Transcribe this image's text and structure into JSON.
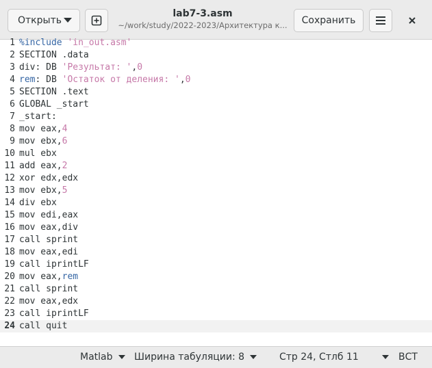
{
  "header": {
    "open_label": "Открыть",
    "save_label": "Сохранить",
    "title": "lab7-3.asm",
    "path": "~/work/study/2022-2023/Архитектура к..."
  },
  "editor": {
    "current_line": 24,
    "lines": [
      {
        "n": "1",
        "parts": [
          [
            "pp",
            "%include "
          ],
          [
            "str",
            "'in_out.asm'"
          ]
        ]
      },
      {
        "n": "2",
        "parts": [
          [
            "t",
            "SECTION .data"
          ]
        ]
      },
      {
        "n": "3",
        "parts": [
          [
            "t",
            "div: DB "
          ],
          [
            "str",
            "'Результат: '"
          ],
          [
            "t",
            ","
          ],
          [
            "num",
            "0"
          ]
        ]
      },
      {
        "n": "4",
        "parts": [
          [
            "kw",
            "rem"
          ],
          [
            "t",
            ": DB "
          ],
          [
            "str",
            "'Остаток от деления: '"
          ],
          [
            "t",
            ","
          ],
          [
            "num",
            "0"
          ]
        ]
      },
      {
        "n": "5",
        "parts": [
          [
            "t",
            "SECTION .text"
          ]
        ]
      },
      {
        "n": "6",
        "parts": [
          [
            "t",
            "GLOBAL _start"
          ]
        ]
      },
      {
        "n": "7",
        "parts": [
          [
            "t",
            "_start:"
          ]
        ]
      },
      {
        "n": "8",
        "parts": [
          [
            "t",
            "mov eax,"
          ],
          [
            "num",
            "4"
          ]
        ]
      },
      {
        "n": "9",
        "parts": [
          [
            "t",
            "mov ebx,"
          ],
          [
            "num",
            "6"
          ]
        ]
      },
      {
        "n": "10",
        "parts": [
          [
            "t",
            "mul ebx"
          ]
        ]
      },
      {
        "n": "11",
        "parts": [
          [
            "t",
            "add eax,"
          ],
          [
            "num",
            "2"
          ]
        ]
      },
      {
        "n": "12",
        "parts": [
          [
            "t",
            "xor edx,edx"
          ]
        ]
      },
      {
        "n": "13",
        "parts": [
          [
            "t",
            "mov ebx,"
          ],
          [
            "num",
            "5"
          ]
        ]
      },
      {
        "n": "14",
        "parts": [
          [
            "t",
            "div ebx"
          ]
        ]
      },
      {
        "n": "15",
        "parts": [
          [
            "t",
            "mov edi,eax"
          ]
        ]
      },
      {
        "n": "16",
        "parts": [
          [
            "t",
            "mov eax,div"
          ]
        ]
      },
      {
        "n": "17",
        "parts": [
          [
            "t",
            "call sprint"
          ]
        ]
      },
      {
        "n": "18",
        "parts": [
          [
            "t",
            "mov eax,edi"
          ]
        ]
      },
      {
        "n": "19",
        "parts": [
          [
            "t",
            "call iprintLF"
          ]
        ]
      },
      {
        "n": "20",
        "parts": [
          [
            "t",
            "mov eax,"
          ],
          [
            "kw",
            "rem"
          ]
        ]
      },
      {
        "n": "21",
        "parts": [
          [
            "t",
            "call sprint"
          ]
        ]
      },
      {
        "n": "22",
        "parts": [
          [
            "t",
            "mov eax,edx"
          ]
        ]
      },
      {
        "n": "23",
        "parts": [
          [
            "t",
            "call iprintLF"
          ]
        ]
      },
      {
        "n": "24",
        "parts": [
          [
            "t",
            "call quit"
          ]
        ]
      }
    ]
  },
  "statusbar": {
    "language": "Matlab",
    "tab_width": "Ширина табуляции: 8",
    "position": "Стр 24, Стлб 11",
    "insert_mode": "ВСТ"
  },
  "icons": {
    "new_tab": "plus-square-icon",
    "menu": "hamburger-menu-icon",
    "close": "close-icon",
    "dropdown": "chevron-down-icon"
  }
}
